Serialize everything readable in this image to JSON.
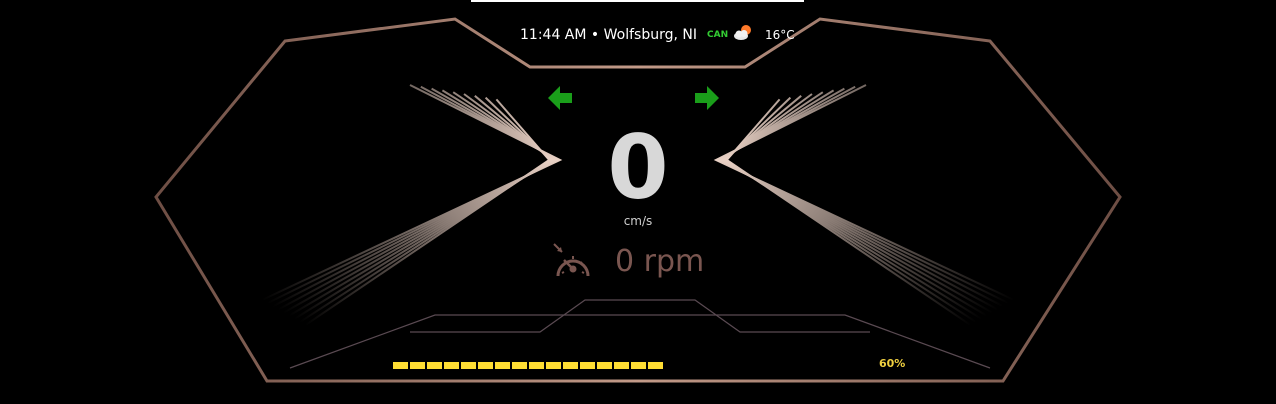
{
  "status_bar": {
    "time": "11:44 AM",
    "separator": "•",
    "location": "Wolfsburg, NI",
    "can_label": "CAN",
    "weather_icon": "partly-cloudy-icon",
    "temperature": "16°C"
  },
  "indicators": {
    "left_turn": "left-turn-arrow-icon",
    "right_turn": "right-turn-arrow-icon",
    "color": "#1a9e1a"
  },
  "speed": {
    "value": "0",
    "unit": "cm/s"
  },
  "rpm": {
    "icon": "speedometer-icon",
    "text": "0 rpm"
  },
  "battery": {
    "level": 0.6,
    "segments_filled": 16,
    "label": "60%",
    "color": "#ffdd33"
  },
  "frame_color": "#a07a6a"
}
